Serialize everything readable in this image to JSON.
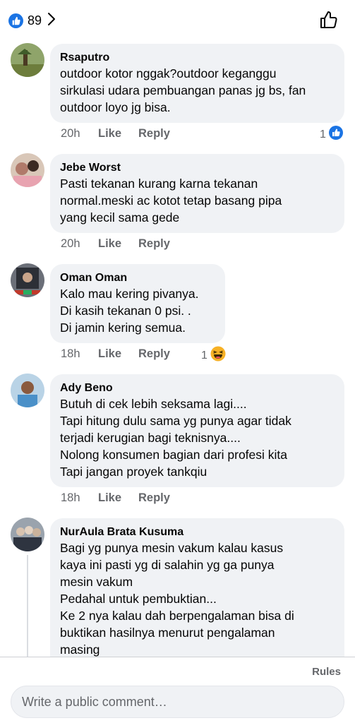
{
  "header": {
    "reaction_count": "89",
    "reaction_icon": "like-icon",
    "chevron_icon": "chevron-right-icon",
    "like_button_icon": "thumbs-up-outline-icon"
  },
  "colors": {
    "accent": "#1b74e4",
    "bubble": "#f0f2f5",
    "meta_text": "#65676b",
    "haha_yellow": "#f7b125"
  },
  "comments": [
    {
      "author": "Rsaputro",
      "text": "outdoor kotor nggak?outdoor keganggu\nsirkulasi udara pembuangan panas jg bs, fan\noutdoor loyo jg bisa.",
      "time": "20h",
      "like_label": "Like",
      "reply_label": "Reply",
      "reaction": {
        "count": "1",
        "type": "like-icon"
      }
    },
    {
      "author": "Jebe Worst",
      "text": "Pasti tekanan kurang karna tekanan\nnormal.meski ac kotot tetap basang pipa\nyang kecil sama gede",
      "time": "20h",
      "like_label": "Like",
      "reply_label": "Reply"
    },
    {
      "author": "Oman Oman",
      "text": "Kalo mau kering pivanya.\nDi kasih tekanan 0 psi. .\nDi jamin kering semua.",
      "time": "18h",
      "like_label": "Like",
      "reply_label": "Reply",
      "reaction": {
        "count": "1",
        "type": "haha-icon"
      }
    },
    {
      "author": "Ady Beno",
      "text": "Butuh di cek lebih seksama lagi....\nTapi hitung dulu sama yg punya agar tidak\nterjadi kerugian bagi teknisnya....\nNolong konsumen bagian dari profesi kita\nTapi jangan proyek tankqiu",
      "time": "18h",
      "like_label": "Like",
      "reply_label": "Reply"
    },
    {
      "author": "NurAula Brata Kusuma",
      "text": "Bagi yg punya mesin vakum kalau kasus\nkaya ini  pasti yg di salahin yg ga punya\nmesin vakum\nPedahal untuk pembuktian...\nKe 2 nya kalau dah berpengalaman bisa di\nbuktikan hasilnya menurut pengalaman\nmasing"
    }
  ],
  "footer": {
    "rules_label": "Rules",
    "composer_placeholder": "Write a public comment…"
  }
}
